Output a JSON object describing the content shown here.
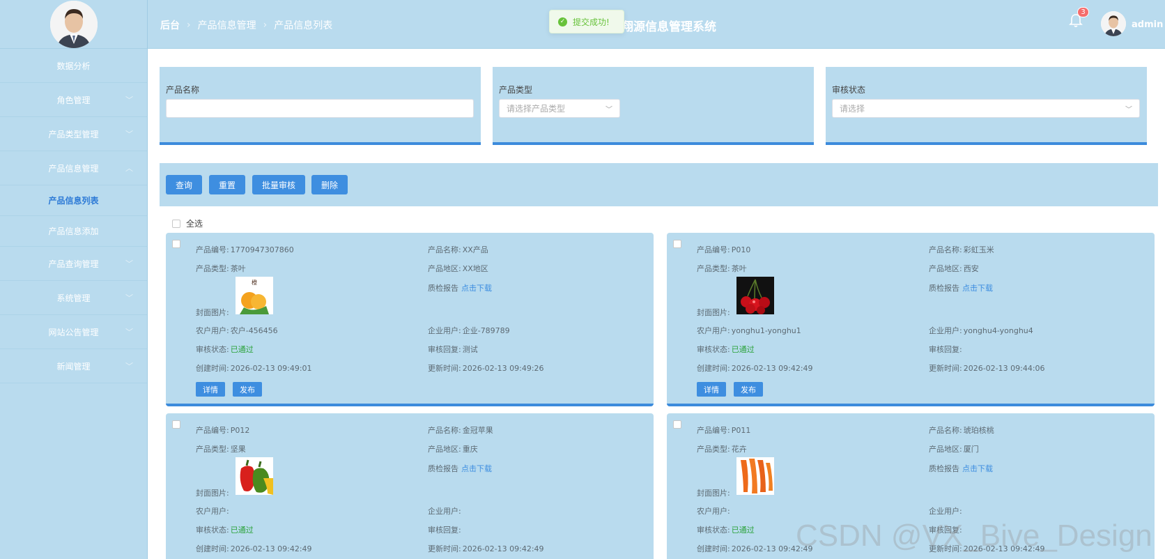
{
  "sidebar": {
    "items": [
      {
        "label": "数据分析"
      },
      {
        "label": "角色管理"
      },
      {
        "label": "产品类型管理"
      },
      {
        "label": "产品信息管理"
      },
      {
        "label": "产品信息列表"
      },
      {
        "label": "产品信息添加"
      },
      {
        "label": "产品查询管理"
      },
      {
        "label": "系统管理"
      },
      {
        "label": "网站公告管理"
      },
      {
        "label": "新闻管理"
      }
    ]
  },
  "header": {
    "breadcrumb": [
      "后台",
      "产品信息管理",
      "产品信息列表"
    ],
    "title": "翔源信息管理系统",
    "toast": "提交成功!",
    "notification_count": "3",
    "username": "admin"
  },
  "filters": {
    "name_label": "产品名称",
    "type_label": "产品类型",
    "type_placeholder": "请选择产品类型",
    "status_label": "审核状态",
    "status_placeholder": "请选择"
  },
  "actions": {
    "query": "查询",
    "reset": "重置",
    "batch_review": "批量审核",
    "delete": "删除",
    "select_all": "全选"
  },
  "labels": {
    "code": "产品编号:",
    "name": "产品名称:",
    "type": "产品类型:",
    "region": "产品地区:",
    "report": "质检报告",
    "download": "点击下载",
    "cover": "封面图片:",
    "farmer": "农户用户:",
    "company": "企业用户:",
    "status": "审核状态:",
    "reply": "审核回复:",
    "created": "创建时间:",
    "updated": "更新时间:",
    "detail_btn": "详情",
    "publish_btn": "发布"
  },
  "products": [
    {
      "code": "1770947307860",
      "name": "XX产品",
      "type": "茶叶",
      "region": "XX地区",
      "farmer": "农户-456456",
      "company": "企业-789789",
      "status": "已通过",
      "reply": "测试",
      "created": "2026-02-13 09:49:01",
      "updated": "2026-02-13 09:49:26",
      "image": "orange-icon"
    },
    {
      "code": "P010",
      "name": "彩虹玉米",
      "type": "茶叶",
      "region": "西安",
      "farmer": "yonghu1-yonghu1",
      "company": "yonghu4-yonghu4",
      "status": "已通过",
      "reply": "",
      "created": "2026-02-13 09:42:49",
      "updated": "2026-02-13 09:44:06",
      "image": "cherry-icon"
    },
    {
      "code": "P012",
      "name": "金冠苹果",
      "type": "坚果",
      "region": "重庆",
      "farmer": "",
      "company": "",
      "status": "已通过",
      "reply": "",
      "created": "2026-02-13 09:42:49",
      "updated": "2026-02-13 09:42:49",
      "image": "pepper-icon"
    },
    {
      "code": "P011",
      "name": "琥珀核桃",
      "type": "花卉",
      "region": "厦门",
      "farmer": "",
      "company": "",
      "status": "已通过",
      "reply": "",
      "created": "2026-02-13 09:42:49",
      "updated": "2026-02-13 09:42:49",
      "image": "carrot-icon"
    }
  ],
  "watermark": "CSDN @VX_Bive_Design",
  "colors": {
    "accent": "#3e8ee0",
    "panel": "#b9dbee",
    "success": "#2aa23a"
  }
}
